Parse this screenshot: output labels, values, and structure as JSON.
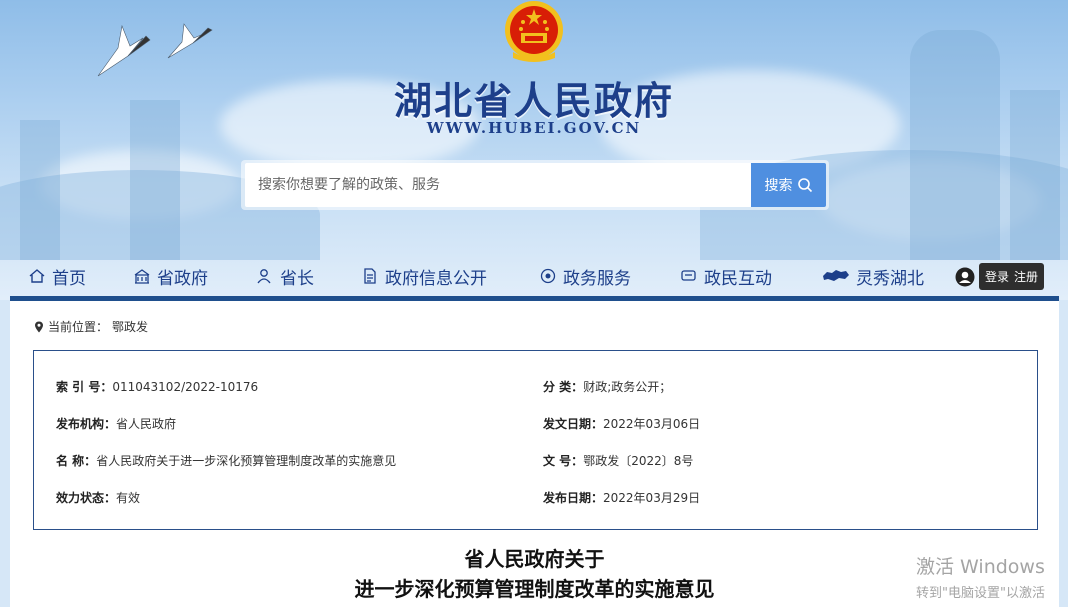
{
  "colors": {
    "brand_blue": "#1d3f8a",
    "search_button": "#4f8fe0",
    "nav_bar": "#1f4f8d",
    "panel_bg": "#ffffff",
    "meta_border": "#2a4f8a"
  },
  "header": {
    "title": "湖北省人民政府",
    "url": "WWW.HUBEI.GOV.CN",
    "emblem_icon": "national-emblem-icon"
  },
  "search": {
    "placeholder": "搜索你想要了解的政策、服务",
    "button_label": "搜索",
    "button_icon": "search-icon"
  },
  "nav": {
    "items": [
      {
        "label": "首页",
        "icon": "home-icon"
      },
      {
        "label": "省政府",
        "icon": "building-icon"
      },
      {
        "label": "省长",
        "icon": "person-icon"
      },
      {
        "label": "政府信息公开",
        "icon": "document-icon"
      },
      {
        "label": "政务服务",
        "icon": "service-icon"
      },
      {
        "label": "政民互动",
        "icon": "chat-icon"
      },
      {
        "label": "灵秀湖北",
        "icon": "hubei-map-icon"
      }
    ],
    "login_label": "登录",
    "register_label": "注册",
    "user_icon": "user-icon"
  },
  "breadcrumb": {
    "prefix": "当前位置：",
    "current": "鄂政发",
    "icon": "location-pin-icon"
  },
  "meta": {
    "index_no": {
      "label": "索 引 号：",
      "value": "011043102/2022-10176"
    },
    "category": {
      "label": "分    类：",
      "value": "财政;政务公开；"
    },
    "issuer": {
      "label": "发布机构：",
      "value": "省人民政府"
    },
    "doc_date": {
      "label": "发文日期：",
      "value": "2022年03月06日"
    },
    "name": {
      "label": "名    称：",
      "value": "省人民政府关于进一步深化预算管理制度改革的实施意见"
    },
    "doc_no": {
      "label": "文    号：",
      "value": "鄂政发〔2022〕8号"
    },
    "status": {
      "label": "效力状态：",
      "value": "有效"
    },
    "publish_date": {
      "label": "发布日期：",
      "value": "2022年03月29日"
    }
  },
  "document": {
    "title_line1": "省人民政府关于",
    "title_line2": "进一步深化预算管理制度改革的实施意见"
  },
  "watermark": {
    "line1": "激活 Windows",
    "line2": "转到\"电脑设置\"以激活"
  }
}
